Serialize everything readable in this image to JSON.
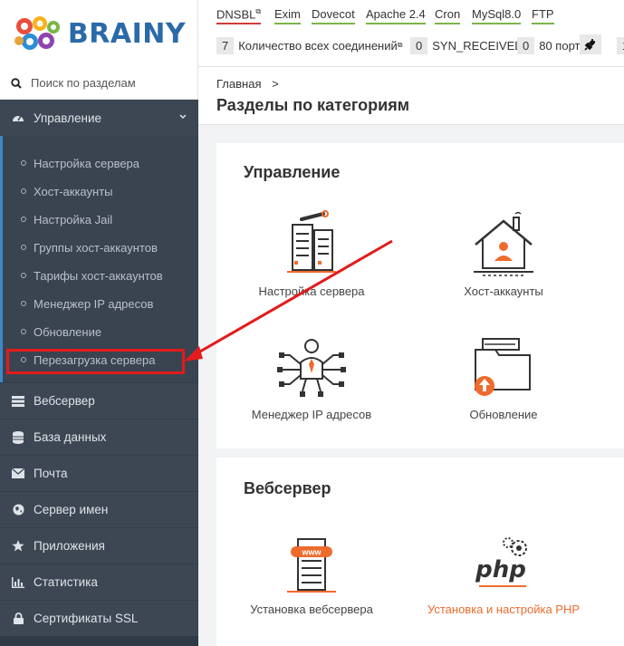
{
  "logo": {
    "text": "BRAINY"
  },
  "search": {
    "placeholder": "Поиск по разделам"
  },
  "sidebar": {
    "section_title": "Управление",
    "subitems": [
      "Настройка сервера",
      "Хост-аккаунты",
      "Настройка Jail",
      "Группы хост-аккаунтов",
      "Тарифы хост-аккаунтов",
      "Менеджер IP адресов",
      "Обновление",
      "Перезагрузка сервера"
    ],
    "items": [
      {
        "label": "Вебсервер",
        "icon": "server-icon"
      },
      {
        "label": "База данных",
        "icon": "database-icon"
      },
      {
        "label": "Почта",
        "icon": "envelope-icon"
      },
      {
        "label": "Сервер имен",
        "icon": "globe-icon"
      },
      {
        "label": "Приложения",
        "icon": "star-icon"
      },
      {
        "label": "Статистика",
        "icon": "bar-chart-icon"
      },
      {
        "label": "Сертификаты SSL",
        "icon": "lock-icon"
      }
    ]
  },
  "topbar": {
    "services": [
      {
        "label": "DNSBL",
        "status": "error"
      },
      {
        "label": "Exim",
        "status": "ok"
      },
      {
        "label": "Dovecot",
        "status": "ok"
      },
      {
        "label": "Apache 2.4",
        "status": "ok"
      },
      {
        "label": "Cron",
        "status": "ok"
      },
      {
        "label": "MySql8.0",
        "status": "ok"
      },
      {
        "label": "FTP",
        "status": "ok"
      }
    ],
    "stats": [
      {
        "count": "7",
        "label": "Количество всех соединений"
      },
      {
        "count": "0",
        "label": "SYN_RECEIVED"
      },
      {
        "count": "0",
        "label": "80 порт"
      }
    ],
    "cut_count": "1"
  },
  "page": {
    "breadcrumb": "Главная",
    "breadcrumb_sep": ">",
    "title": "Разделы по категориям"
  },
  "cards": [
    {
      "title": "Управление",
      "tiles": [
        {
          "label": "Настройка сервера",
          "icon": "server-settings-icon"
        },
        {
          "label": "Хост-аккаунты",
          "icon": "house-icon"
        },
        {
          "label": "Менеджер IP адресов",
          "icon": "network-manager-icon"
        },
        {
          "label": "Обновление",
          "icon": "folder-update-icon"
        }
      ]
    },
    {
      "title": "Вебсервер",
      "tiles": [
        {
          "label": "Установка вебсервера",
          "icon": "www-server-icon"
        },
        {
          "label": "Установка и настройка PHP",
          "icon": "php-icon"
        }
      ]
    }
  ],
  "colors": {
    "sidebar_bg": "#2f3a46",
    "accent_blue": "#3f88c8",
    "accent_orange": "#ee6b2d",
    "highlight_red": "#e21b1b",
    "status_ok": "#7ab648",
    "status_error": "#d23a3a"
  }
}
